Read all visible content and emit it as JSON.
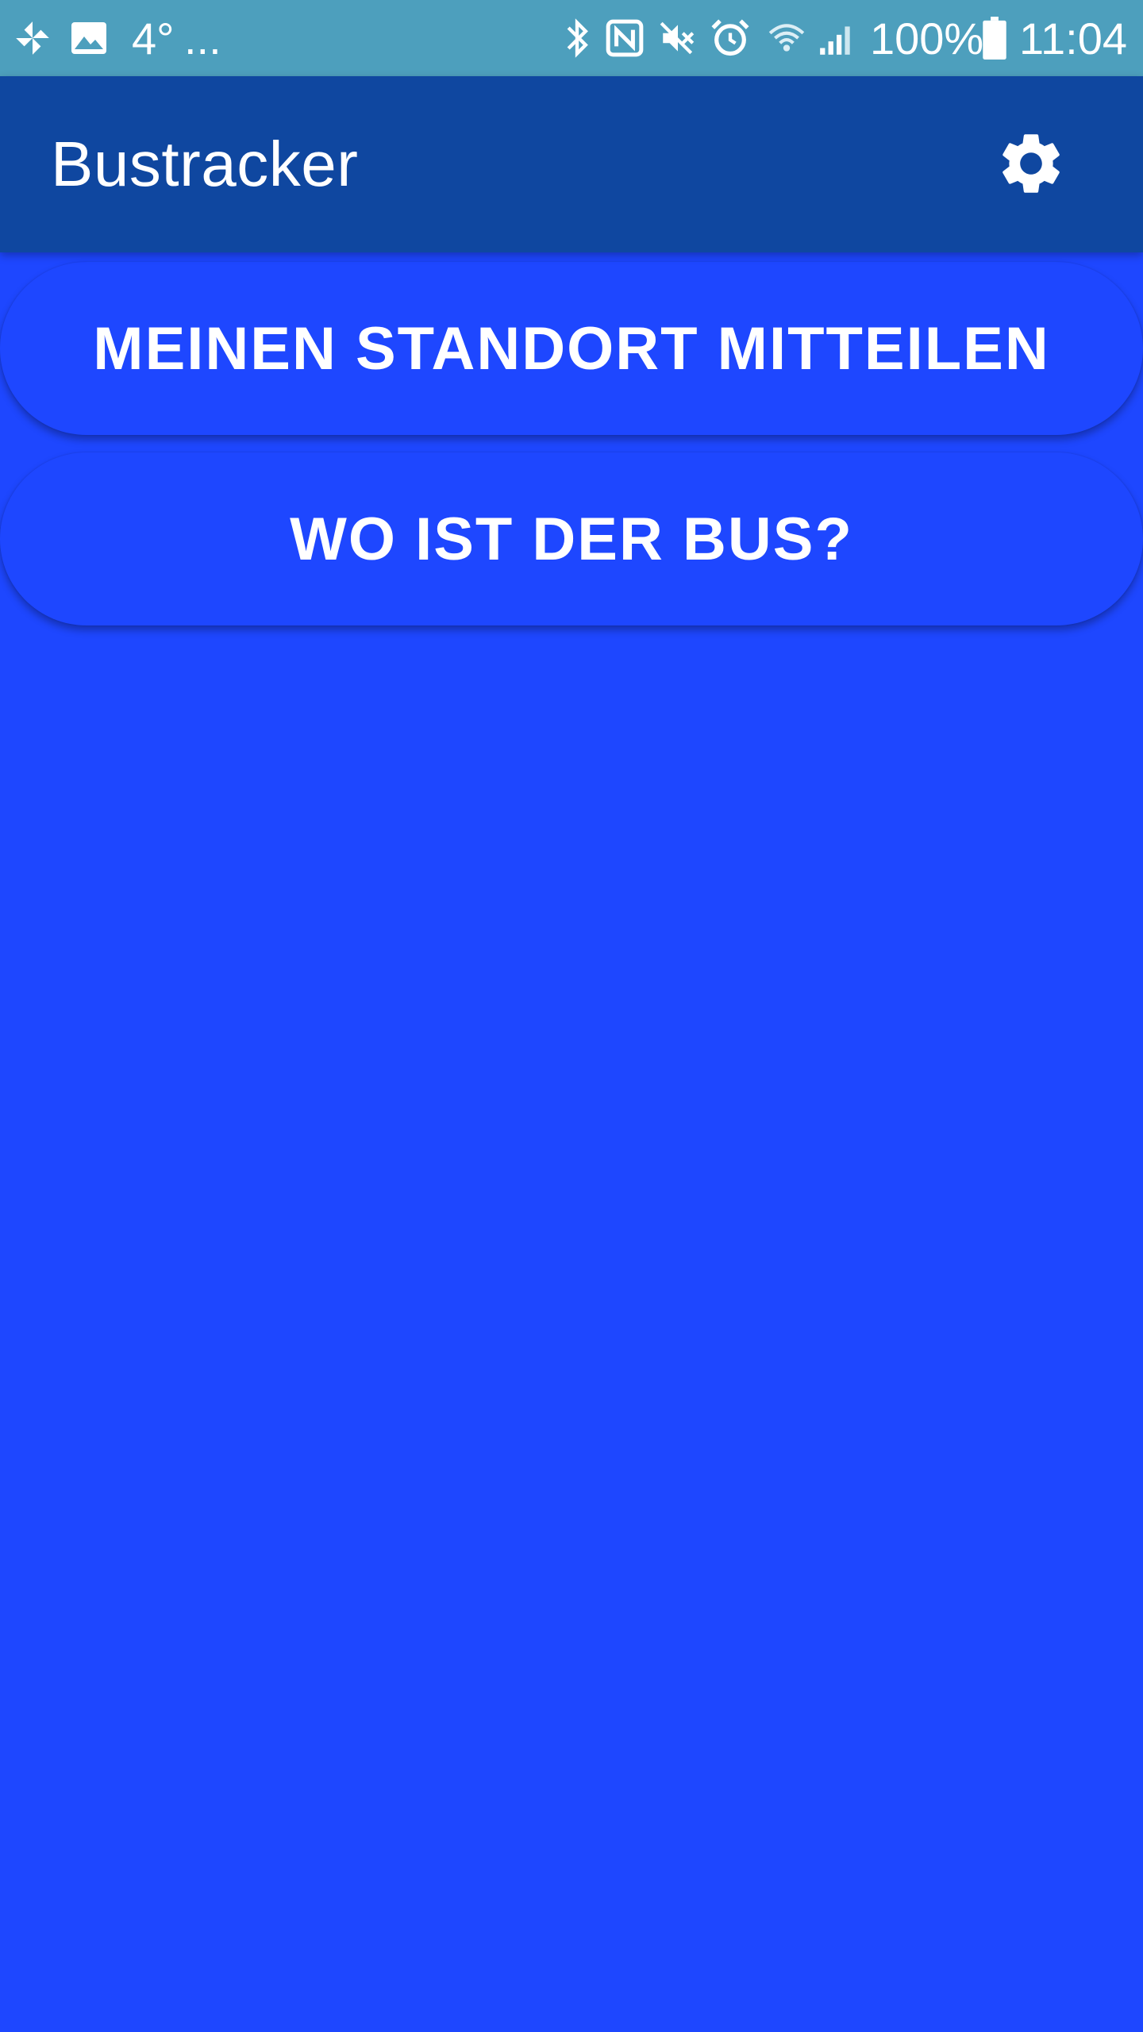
{
  "colors": {
    "status_bar": "#4d9fbd",
    "app_bar": "#0f47a0",
    "background": "#1e47ff",
    "button": "#1e47ff",
    "text": "#ffffff"
  },
  "status_bar": {
    "left_icons": [
      "pinwheel-icon",
      "gallery-icon"
    ],
    "temperature": "4°",
    "overflow": "...",
    "right_icons": [
      "bluetooth-icon",
      "nfc-icon",
      "mute-icon",
      "alarm-icon",
      "wifi-icon",
      "signal-icon"
    ],
    "battery_percent": "100%",
    "battery_icon": "battery-full-icon",
    "time": "11:04"
  },
  "app_bar": {
    "title": "Bustracker",
    "settings_icon": "gear-icon"
  },
  "main": {
    "share_location_label": "MEINEN STANDORT MITTEILEN",
    "where_is_bus_label": "WO IST DER BUS?"
  }
}
